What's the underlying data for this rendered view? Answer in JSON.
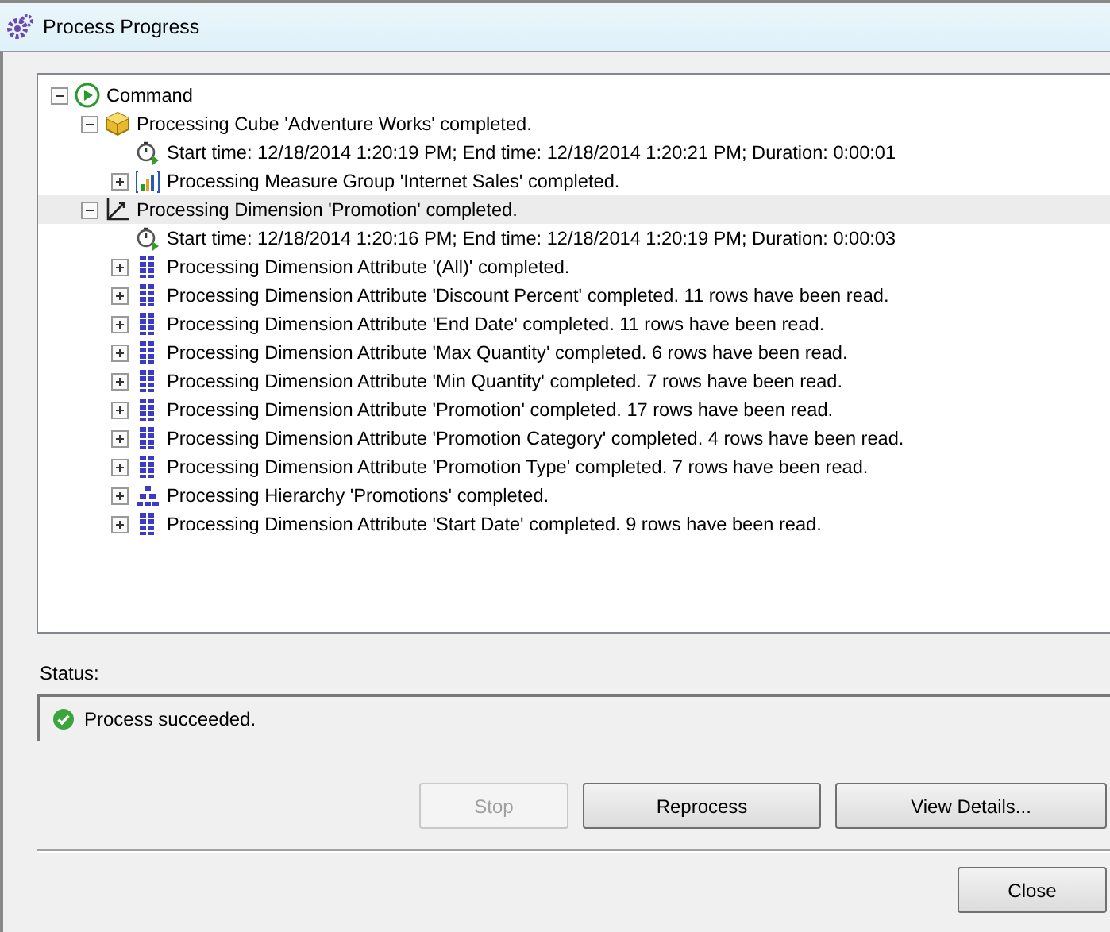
{
  "window": {
    "title": "Process Progress"
  },
  "tree": [
    {
      "kind": "command",
      "text": "Command",
      "expanded": true,
      "selected": false,
      "children": [
        {
          "kind": "cube",
          "text": "Processing Cube 'Adventure Works' completed.",
          "expanded": true,
          "selected": false,
          "children": [
            {
              "kind": "timing",
              "text": "Start time: 12/18/2014 1:20:19 PM; End time: 12/18/2014 1:20:21 PM; Duration: 0:00:01",
              "selected": false
            },
            {
              "kind": "measure-group",
              "text": "Processing Measure Group 'Internet Sales' completed.",
              "expanded": false,
              "selected": false
            }
          ]
        },
        {
          "kind": "dimension",
          "text": "Processing Dimension 'Promotion' completed.",
          "expanded": true,
          "selected": true,
          "children": [
            {
              "kind": "timing",
              "text": "Start time: 12/18/2014 1:20:16 PM; End time: 12/18/2014 1:20:19 PM; Duration: 0:00:03",
              "selected": false
            },
            {
              "kind": "attribute",
              "text": "Processing Dimension Attribute '(All)' completed.",
              "expanded": false,
              "selected": false
            },
            {
              "kind": "attribute",
              "text": "Processing Dimension Attribute 'Discount Percent' completed. 11 rows have been read.",
              "expanded": false,
              "selected": false
            },
            {
              "kind": "attribute",
              "text": "Processing Dimension Attribute 'End Date' completed. 11 rows have been read.",
              "expanded": false,
              "selected": false
            },
            {
              "kind": "attribute",
              "text": "Processing Dimension Attribute 'Max Quantity' completed. 6 rows have been read.",
              "expanded": false,
              "selected": false
            },
            {
              "kind": "attribute",
              "text": "Processing Dimension Attribute 'Min Quantity' completed. 7 rows have been read.",
              "expanded": false,
              "selected": false
            },
            {
              "kind": "attribute",
              "text": "Processing Dimension Attribute 'Promotion' completed. 17 rows have been read.",
              "expanded": false,
              "selected": false
            },
            {
              "kind": "attribute",
              "text": "Processing Dimension Attribute 'Promotion Category' completed. 4 rows have been read.",
              "expanded": false,
              "selected": false
            },
            {
              "kind": "attribute",
              "text": "Processing Dimension Attribute 'Promotion Type' completed. 7 rows have been read.",
              "expanded": false,
              "selected": false
            },
            {
              "kind": "hierarchy",
              "text": "Processing Hierarchy 'Promotions' completed.",
              "expanded": false,
              "selected": false
            },
            {
              "kind": "attribute",
              "text": "Processing Dimension Attribute 'Start Date' completed. 9 rows have been read.",
              "expanded": false,
              "selected": false
            }
          ]
        }
      ]
    }
  ],
  "status": {
    "label": "Status:",
    "message": "Process succeeded."
  },
  "buttons": [
    {
      "label": "Stop",
      "disabled": true
    },
    {
      "label": "Reprocess",
      "disabled": false
    },
    {
      "label": "View Details...",
      "disabled": false
    }
  ],
  "close_button": {
    "label": "Close"
  }
}
